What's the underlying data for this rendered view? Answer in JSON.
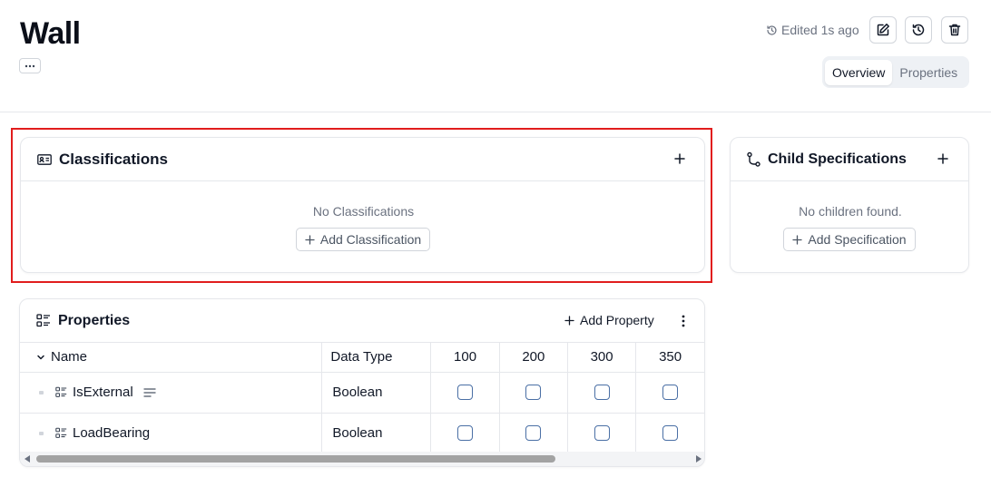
{
  "page": {
    "title": "Wall",
    "edited_text": "Edited 1s ago",
    "tabs": [
      {
        "label": "Overview",
        "active": true
      },
      {
        "label": "Properties",
        "active": false
      }
    ]
  },
  "classifications": {
    "title": "Classifications",
    "empty_text": "No Classifications",
    "add_label": "Add Classification"
  },
  "children": {
    "title": "Child Specifications",
    "empty_text": "No children found.",
    "add_label": "Add Specification"
  },
  "properties": {
    "title": "Properties",
    "add_label": "Add Property",
    "columns": [
      "Name",
      "Data Type",
      "100",
      "200",
      "300",
      "350"
    ],
    "rows": [
      {
        "name": "IsExternal",
        "data_type": "Boolean",
        "has_description": true,
        "checks": [
          false,
          false,
          false,
          false
        ]
      },
      {
        "name": "LoadBearing",
        "data_type": "Boolean",
        "has_description": false,
        "checks": [
          false,
          false,
          false,
          false
        ]
      }
    ]
  },
  "icons": {
    "more": "ellipsis-icon",
    "history": "history-icon",
    "edit": "edit-icon",
    "restore": "restore-icon",
    "delete": "trash-icon",
    "classifications": "id-card-icon",
    "children": "branch-icon",
    "properties": "list-icon"
  },
  "colors": {
    "highlight": "#e11d1d",
    "checkbox_border": "#4a6fa5"
  }
}
